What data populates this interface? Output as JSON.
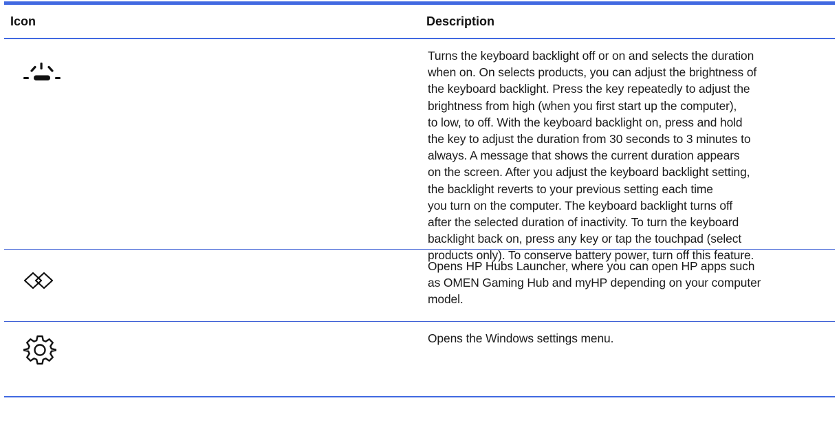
{
  "table": {
    "header": {
      "icon_label": "Icon",
      "description_label": "Description"
    },
    "rows": [
      {
        "icon": "keyboard-backlight-icon",
        "description": "Turns the keyboard backlight off or on and selects the duration\nwhen on. On selects products, you can adjust the brightness of\nthe keyboard backlight. Press the key repeatedly to adjust the\nbrightness from high (when you first start up the computer),\nto low, to off. With the keyboard backlight on, press and hold\nthe key to adjust the duration from 30 seconds to 3 minutes to\nalways. A message that shows the current duration appears\non the screen. After you adjust the keyboard backlight setting,\nthe backlight reverts to your previous setting each time\nyou turn on the computer. The keyboard backlight turns off\nafter the selected duration of inactivity. To turn the keyboard\nbacklight back on, press any key or tap the touchpad (select\nproducts only). To conserve battery power, turn off this feature."
      },
      {
        "icon": "hp-hubs-launcher-icon",
        "description": "Opens HP Hubs Launcher, where you can open HP apps such\nas OMEN Gaming Hub and myHP depending on your computer\nmodel."
      },
      {
        "icon": "settings-gear-icon",
        "description": "Opens the Windows settings menu."
      }
    ]
  },
  "colors": {
    "rule": "#4169e1",
    "text": "#1a1a1a"
  }
}
